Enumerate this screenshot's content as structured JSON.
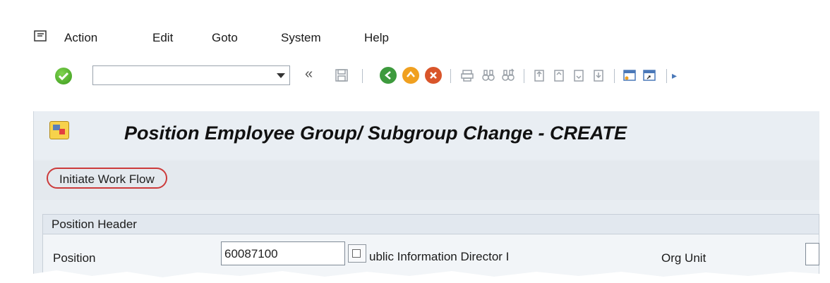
{
  "menu": {
    "items": [
      "Action",
      "Edit",
      "Goto",
      "System",
      "Help"
    ]
  },
  "toolbar": {
    "command_value": "",
    "back_glyph": "«"
  },
  "screen": {
    "title": "Position Employee Group/ Subgroup Change - CREATE",
    "workflow_button": "Initiate Work Flow"
  },
  "position_header": {
    "title": "Position Header",
    "position_label": "Position",
    "position_value": "60087100",
    "position_text": "ublic Information Director I",
    "org_unit_label": "Org Unit"
  },
  "icons": {
    "menu": "menu-icon",
    "enter": "green-check-icon",
    "save": "save-icon",
    "back": "back-icon",
    "exit": "exit-icon",
    "cancel": "cancel-icon",
    "print": "print-icon",
    "find": "find-icon",
    "find_next": "find-next-icon",
    "first_page": "first-page-icon",
    "prev_page": "previous-page-icon",
    "next_page": "next-page-icon",
    "last_page": "last-page-icon",
    "new_session": "new-session-icon",
    "shortcut": "shortcut-icon"
  },
  "colors": {
    "highlight": "#cc3a3a",
    "enter_green": "#3a9a1c",
    "back_green": "#3d9a3d",
    "exit_orange": "#f0a020",
    "cancel_orange": "#d9552a"
  }
}
